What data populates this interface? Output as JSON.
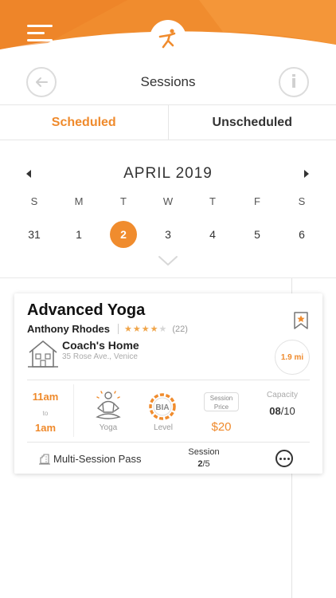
{
  "header": {
    "title": "Sessions",
    "info_label": "i",
    "colors": {
      "accent": "#f08c2e",
      "accent_light": "#f7a04a"
    }
  },
  "tabs": [
    {
      "label": "Scheduled",
      "active": true
    },
    {
      "label": "Unscheduled",
      "active": false
    }
  ],
  "calendar": {
    "month": "APRIL 2019",
    "weekdays": [
      "S",
      "M",
      "T",
      "W",
      "T",
      "F",
      "S"
    ],
    "dates": [
      "31",
      "1",
      "2",
      "3",
      "4",
      "5",
      "6"
    ],
    "selected": "2"
  },
  "session": {
    "title": "Advanced Yoga",
    "coach": "Anthony Rhodes",
    "rating": 3.5,
    "rating_max": 5,
    "reviews": "(22)",
    "location_name": "Coach's Home",
    "location_address": "35 Rose Ave., Venice",
    "distance": "1.9 mi",
    "time_start": "11am",
    "time_to": "to",
    "time_end": "1am",
    "type_label": "Yoga",
    "level_badge": "BIA",
    "level_label": "Level",
    "price_label_1": "Session",
    "price_label_2": "Price",
    "price": "$20",
    "capacity_label": "Capacity",
    "capacity_filled": "08",
    "capacity_total": "/10",
    "pass_label": "Multi-Session Pass",
    "session_label": "Session",
    "session_current": "2",
    "session_total": "/5"
  }
}
